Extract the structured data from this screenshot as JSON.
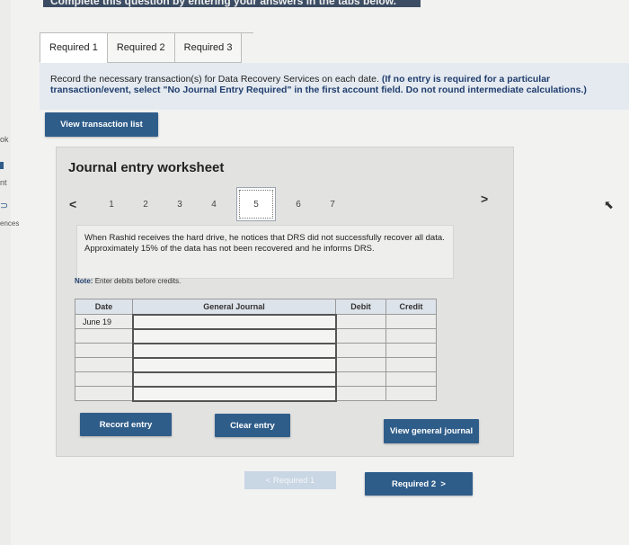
{
  "top_banner": "Complete this question by entering your answers in the tabs below.",
  "left_sidebar": {
    "items": [
      "ok",
      "nt",
      "ences"
    ]
  },
  "tabs": [
    {
      "label": "Required 1",
      "active": true
    },
    {
      "label": "Required 2",
      "active": false
    },
    {
      "label": "Required 3",
      "active": false
    }
  ],
  "instructions": {
    "text": "Record the necessary transaction(s) for Data Recovery Services on each date.",
    "paren": "(If no entry is required for a particular transaction/event, select \"No Journal Entry Required\" in the first account field. Do not round intermediate calculations.)"
  },
  "view_transaction_list": "View transaction list",
  "worksheet": {
    "title": "Journal entry worksheet",
    "pages": [
      "1",
      "2",
      "3",
      "4",
      "5",
      "6",
      "7"
    ],
    "active_page": "5",
    "description": "When Rashid receives the hard drive, he notices that DRS did not successfully recover all data. Approximately 15% of the data has not been recovered and he informs DRS.",
    "note_label": "Note:",
    "note_text": "Enter debits before credits.",
    "table": {
      "headers": {
        "date": "Date",
        "journal": "General Journal",
        "debit": "Debit",
        "credit": "Credit"
      },
      "rows": [
        {
          "date": "June 19",
          "account": "",
          "debit": "",
          "credit": ""
        },
        {
          "date": "",
          "account": "",
          "debit": "",
          "credit": ""
        },
        {
          "date": "",
          "account": "",
          "debit": "",
          "credit": ""
        },
        {
          "date": "",
          "account": "",
          "debit": "",
          "credit": ""
        },
        {
          "date": "",
          "account": "",
          "debit": "",
          "credit": ""
        },
        {
          "date": "",
          "account": "",
          "debit": "",
          "credit": ""
        }
      ]
    },
    "record_entry": "Record entry",
    "clear_entry": "Clear entry",
    "view_general_journal": "View general journal"
  },
  "nav": {
    "prev_label": "Required 1",
    "next_label": "Required 2"
  },
  "colors": {
    "primary": "#2f5d8a",
    "instruction_bg": "#e4eaf0",
    "panel_bg": "#e2e2e0"
  }
}
